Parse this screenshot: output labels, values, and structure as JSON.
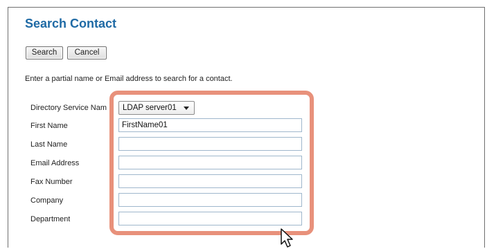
{
  "page": {
    "title": "Search Contact",
    "instructions": "Enter a partial name or Email address to search for a contact."
  },
  "toolbar": {
    "search_label": "Search",
    "cancel_label": "Cancel"
  },
  "form": {
    "directory_service": {
      "label": "Directory Service Nam",
      "value": "LDAP server01",
      "icon": "chevron-down-icon"
    },
    "first_name": {
      "label": "First Name",
      "value": "FirstName01"
    },
    "last_name": {
      "label": "Last Name",
      "value": ""
    },
    "email_address": {
      "label": "Email Address",
      "value": ""
    },
    "fax_number": {
      "label": "Fax Number",
      "value": ""
    },
    "company": {
      "label": "Company",
      "value": ""
    },
    "department": {
      "label": "Department",
      "value": ""
    }
  },
  "annotation": {
    "highlight_color": "#e8917b",
    "cursor_icon": "mouse-pointer-icon"
  },
  "colors": {
    "title": "#1f6aa5",
    "field_border": "#9fb7cc"
  }
}
